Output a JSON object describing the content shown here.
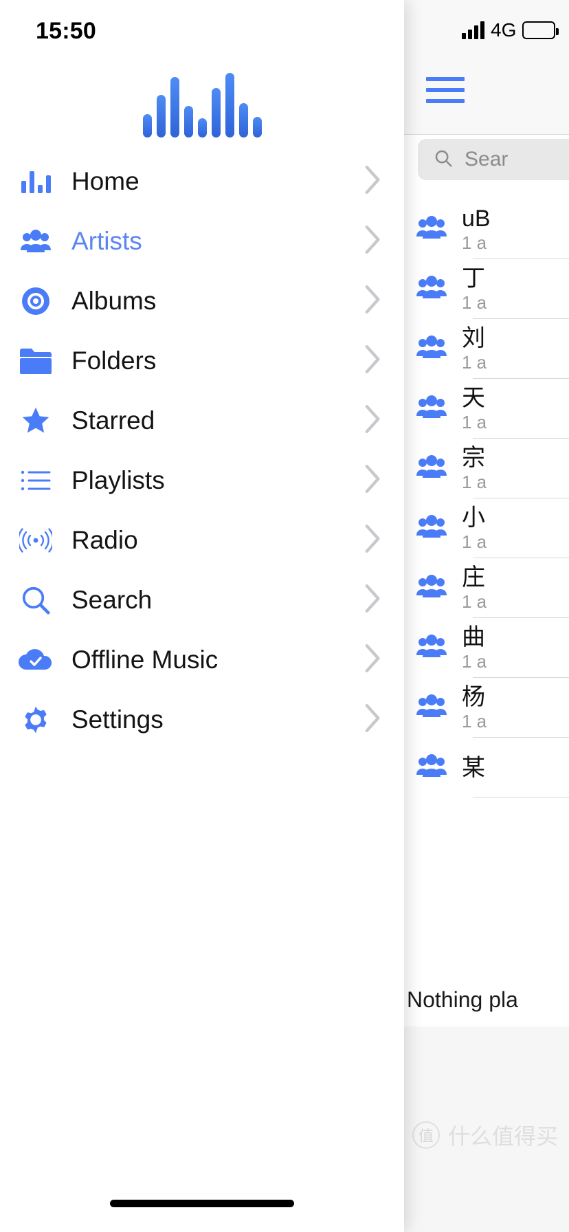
{
  "status_bar": {
    "time": "15:50",
    "network": "4G",
    "signal_icon": "cellular-signal-icon",
    "battery_icon": "battery-icon"
  },
  "drawer": {
    "logo_icon": "waveform-logo-icon",
    "items": [
      {
        "label": "Home",
        "icon": "equalizer-icon",
        "active": false,
        "chevron": "chevron-right-icon"
      },
      {
        "label": "Artists",
        "icon": "artists-icon",
        "active": true,
        "chevron": "chevron-right-icon"
      },
      {
        "label": "Albums",
        "icon": "album-disc-icon",
        "active": false,
        "chevron": "chevron-right-icon"
      },
      {
        "label": "Folders",
        "icon": "folder-icon",
        "active": false,
        "chevron": "chevron-right-icon"
      },
      {
        "label": "Starred",
        "icon": "star-icon",
        "active": false,
        "chevron": "chevron-right-icon"
      },
      {
        "label": "Playlists",
        "icon": "list-icon",
        "active": false,
        "chevron": "chevron-right-icon"
      },
      {
        "label": "Radio",
        "icon": "radio-waves-icon",
        "active": false,
        "chevron": "chevron-right-icon"
      },
      {
        "label": "Search",
        "icon": "search-icon",
        "active": false,
        "chevron": "chevron-right-icon"
      },
      {
        "label": "Offline Music",
        "icon": "cloud-check-icon",
        "active": false,
        "chevron": "chevron-right-icon"
      },
      {
        "label": "Settings",
        "icon": "gear-icon",
        "active": false,
        "chevron": "chevron-right-icon"
      }
    ]
  },
  "background_panel": {
    "menu_button_icon": "hamburger-menu-icon",
    "search": {
      "icon": "search-icon",
      "placeholder": "Sear",
      "value": ""
    },
    "artists": [
      {
        "name": "uB",
        "subtitle": "1 a",
        "icon": "artists-icon"
      },
      {
        "name": "丁",
        "subtitle": "1 a",
        "icon": "artists-icon"
      },
      {
        "name": "刘",
        "subtitle": "1 a",
        "icon": "artists-icon"
      },
      {
        "name": "天",
        "subtitle": "1 a",
        "icon": "artists-icon"
      },
      {
        "name": "宗",
        "subtitle": "1 a",
        "icon": "artists-icon"
      },
      {
        "name": "小",
        "subtitle": "1 a",
        "icon": "artists-icon"
      },
      {
        "name": "庄",
        "subtitle": "1 a",
        "icon": "artists-icon"
      },
      {
        "name": "曲",
        "subtitle": "1 a",
        "icon": "artists-icon"
      },
      {
        "name": "杨",
        "subtitle": "1 a",
        "icon": "artists-icon"
      },
      {
        "name": "某",
        "subtitle": "",
        "icon": "artists-icon"
      }
    ],
    "now_playing": "Nothing pla"
  },
  "watermark": {
    "mark": "值",
    "text": "什么值得买"
  },
  "colors": {
    "accent": "#4a7cf7",
    "accent_active_text": "#5b86f2",
    "chevron": "#c9c9cd",
    "text_primary": "#141414",
    "text_muted": "#9a9a9e",
    "search_bg": "#e8e8e9",
    "navbar_bg": "#f8f8f8",
    "tabbar_bg": "#f6f6f6"
  },
  "home_indicator": "home-indicator"
}
